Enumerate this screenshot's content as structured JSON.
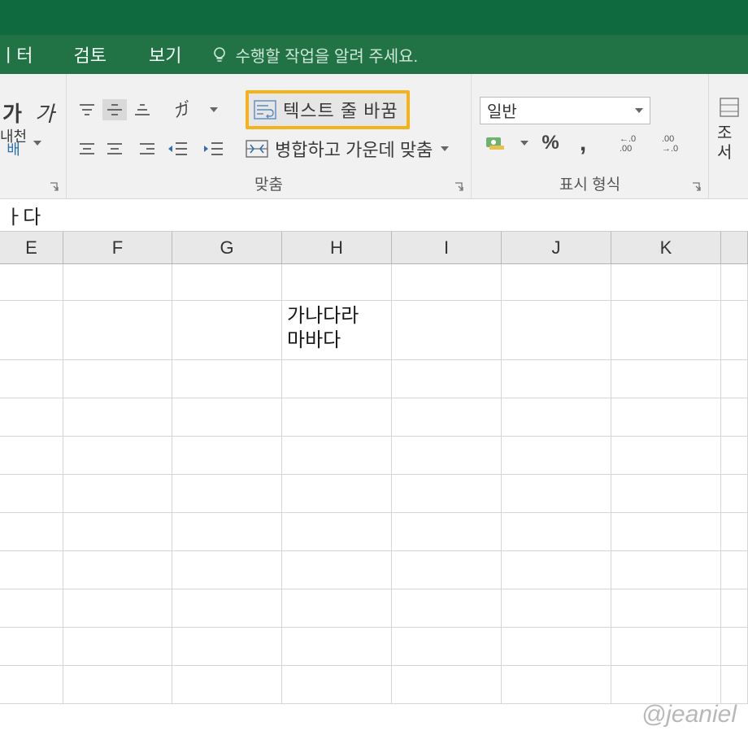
{
  "tabs": {
    "data_partial": "ㅣ터",
    "review": "검토",
    "view": "보기",
    "tellme": "수행할 작업을 알려 주세요."
  },
  "ribbon": {
    "font": {
      "bold": "가",
      "italic": "가",
      "ruby_top": "내천",
      "ruby_bottom": "배"
    },
    "align": {
      "wrap_label": "텍스트 줄 바꿈",
      "merge_label": "병합하고 가운데 맞춤",
      "group_label": "맞춤"
    },
    "number": {
      "combo_value": "일반",
      "group_label": "표시 형식",
      "pct": "%",
      "comma": ",",
      "inc_dec": "←.0",
      "dec_inc": ".00→"
    },
    "rightcut": {
      "top": "조",
      "bot": "서"
    }
  },
  "formula_bar": {
    "text": "ㅏ다"
  },
  "columns": [
    "E",
    "F",
    "G",
    "H",
    "I",
    "J",
    "K"
  ],
  "cells": {
    "H2": "가나다라\n마바다"
  },
  "watermark": "@jeaniel"
}
